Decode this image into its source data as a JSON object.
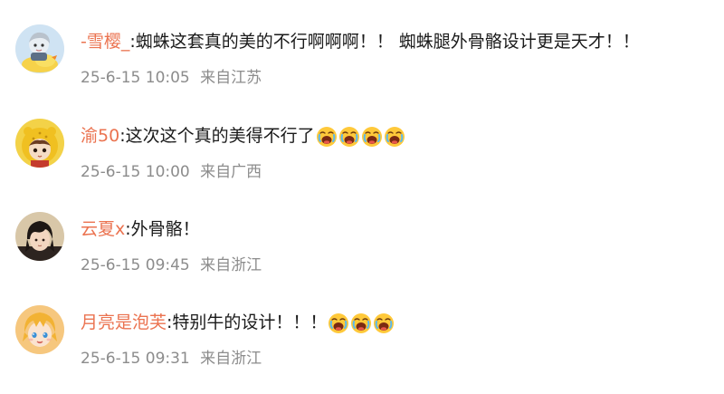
{
  "comments": [
    {
      "username": "-雪樱_",
      "colon": ":",
      "text": "蜘蛛这套真的美的不行啊啊啊！！ 蜘蛛腿外骨骼设计更是天才！！",
      "emoji_count": 0,
      "emoji_name": "",
      "time": "25-6-15 10:05",
      "location": "来自江苏",
      "avatar": {
        "icon": "avatar-duck-character",
        "bg": "#cfe3f3"
      }
    },
    {
      "username": "渝50",
      "colon": ":",
      "text": "这次这个真的美得不行了",
      "emoji_count": 4,
      "emoji_name": "crying-face-emoji",
      "time": "25-6-15 10:00",
      "location": "来自广西",
      "avatar": {
        "icon": "avatar-yellow-hood-character",
        "bg": "#f3d248"
      }
    },
    {
      "username": "云夏x",
      "colon": ":",
      "text": "外骨骼！",
      "emoji_count": 0,
      "emoji_name": "",
      "time": "25-6-15 09:45",
      "location": "来自浙江",
      "avatar": {
        "icon": "avatar-dark-hair-character",
        "bg": "#d8c7a8"
      }
    },
    {
      "username": "月亮是泡芙",
      "colon": ":",
      "text": "特别牛的设计！！！",
      "emoji_count": 3,
      "emoji_name": "crying-face-emoji",
      "time": "25-6-15 09:31",
      "location": "来自浙江",
      "avatar": {
        "icon": "avatar-blonde-anime-character",
        "bg": "#f6c77e"
      }
    }
  ],
  "colors": {
    "username": "#eb7350",
    "text": "#1a1a1a",
    "meta": "#8c8c8c",
    "emoji_face": "#ffc93a"
  }
}
